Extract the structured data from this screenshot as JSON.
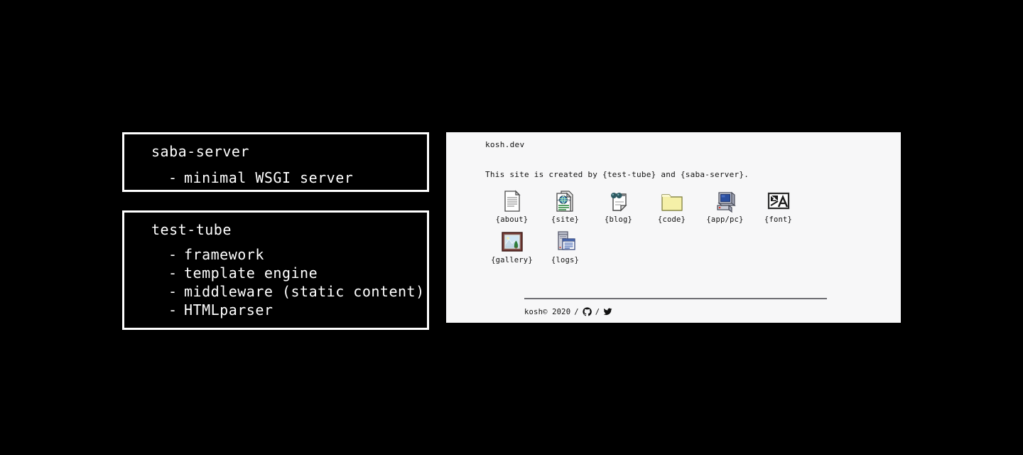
{
  "theme": {
    "page_background": "#000000",
    "card_border": "#ffffff",
    "card_text": "#ffffff",
    "site_background": "#f7f7f8",
    "site_text": "#111111",
    "footer_rule": "#6d6d72"
  },
  "spec_cards": [
    {
      "id": "saba-server",
      "title": "saba-server",
      "items": [
        "minimal WSGI server"
      ]
    },
    {
      "id": "test-tube",
      "title": "test-tube",
      "items": [
        "framework",
        "template engine",
        "middleware (static content)",
        "HTMLparser"
      ]
    }
  ],
  "bullet": "-",
  "site": {
    "brand": "kosh.dev",
    "tagline": "This site is created by {test-tube} and {saba-server}.",
    "icons": [
      {
        "label": "{about}",
        "icon": "document-icon"
      },
      {
        "label": "{site}",
        "icon": "globe-document-icon"
      },
      {
        "label": "{blog}",
        "icon": "pinned-note-icon"
      },
      {
        "label": "{code}",
        "icon": "folder-icon"
      },
      {
        "label": "{app/pc}",
        "icon": "computer-icon"
      },
      {
        "label": "{font}",
        "icon": "font-icon"
      },
      {
        "label": "{gallery}",
        "icon": "framed-picture-icon"
      },
      {
        "label": "{logs}",
        "icon": "server-window-icon"
      }
    ],
    "footer": {
      "copyright": "kosh© 2020",
      "separator": "/",
      "links": [
        {
          "name": "github-icon",
          "title": "GitHub"
        },
        {
          "name": "twitter-icon",
          "title": "Twitter"
        }
      ]
    }
  }
}
